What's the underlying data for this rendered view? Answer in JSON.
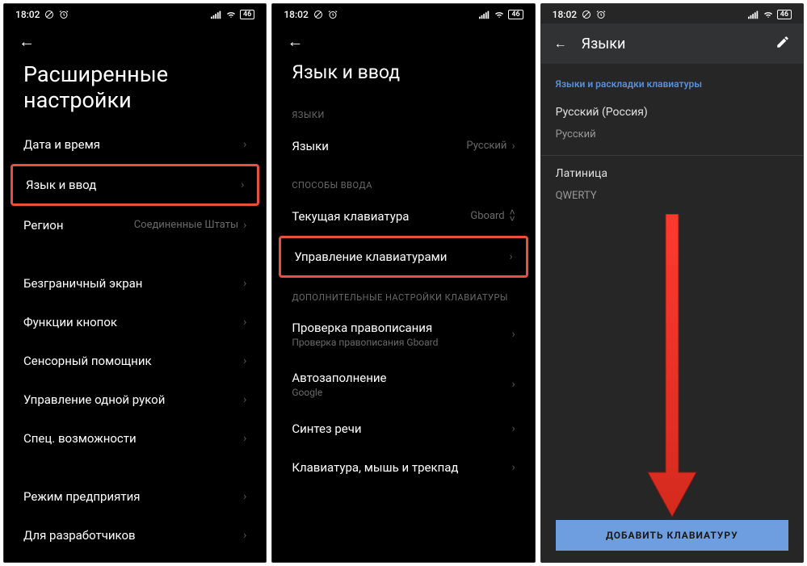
{
  "status": {
    "time": "18:02",
    "battery": "46"
  },
  "s1": {
    "title": "Расширенные настройки",
    "rows": {
      "date_time": "Дата и время",
      "lang_input": "Язык и ввод",
      "region": "Регион",
      "region_val": "Соединенные Штаты",
      "edge": "Безграничный экран",
      "buttons": "Функции кнопок",
      "touch": "Сенсорный помощник",
      "one_hand": "Управление одной рукой",
      "access": "Спец. возможности",
      "enterprise": "Режим предприятия",
      "developer": "Для разработчиков"
    }
  },
  "s2": {
    "title": "Язык и ввод",
    "sec_lang": "ЯЗЫКИ",
    "languages": "Языки",
    "languages_val": "Русский",
    "sec_input": "СПОСОБЫ ВВОДА",
    "current_kb": "Текущая клавиатура",
    "current_kb_val": "Gboard",
    "manage_kb": "Управление клавиатурами",
    "sec_extra": "ДОПОЛНИТЕЛЬНЫЕ НАСТРОЙКИ КЛАВИАТУРЫ",
    "spell": "Проверка правописания",
    "spell_sub": "Проверка правописания Gboard",
    "autofill": "Автозаполнение",
    "autofill_sub": "Google",
    "tts": "Синтез речи",
    "kmt": "Клавиатура, мышь и трекпад"
  },
  "s3": {
    "title": "Языки",
    "header": "Языки и раскладки клавиатуры",
    "lang1": "Русский (Россия)",
    "lang1_sub": "Русский",
    "lang2": "Латиница",
    "lang2_sub": "QWERTY",
    "add": "ДОБАВИТЬ КЛАВИАТУРУ"
  }
}
